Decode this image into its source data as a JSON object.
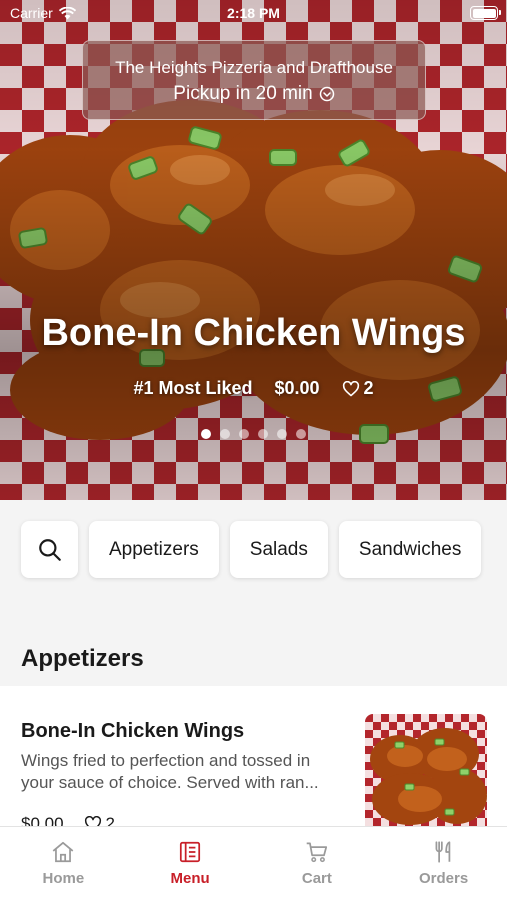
{
  "status_bar": {
    "carrier": "Carrier",
    "time": "2:18 PM"
  },
  "store": {
    "name": "The Heights Pizzeria and Drafthouse",
    "pickup": "Pickup in 20 min"
  },
  "featured": {
    "title": "Bone-In Chicken Wings",
    "badge": "#1 Most Liked",
    "price": "$0.00",
    "likes": "2",
    "carousel": {
      "count": 6,
      "active_index": 0
    }
  },
  "categories": [
    "Appetizers",
    "Salads",
    "Sandwiches"
  ],
  "section": {
    "title": "Appetizers"
  },
  "items": [
    {
      "name": "Bone-In Chicken Wings",
      "description": "Wings fried to perfection and tossed in your sauce of choice. Served with ran...",
      "price": "$0.00",
      "likes": "2"
    }
  ],
  "tabs": [
    {
      "label": "Home",
      "icon": "home-icon",
      "active": false
    },
    {
      "label": "Menu",
      "icon": "menu-book-icon",
      "active": true
    },
    {
      "label": "Cart",
      "icon": "cart-icon",
      "active": false
    },
    {
      "label": "Orders",
      "icon": "fork-knife-icon",
      "active": false
    }
  ],
  "colors": {
    "accent": "#c81f28",
    "inactive": "#9a9a9a",
    "background": "#f4f4f4"
  }
}
